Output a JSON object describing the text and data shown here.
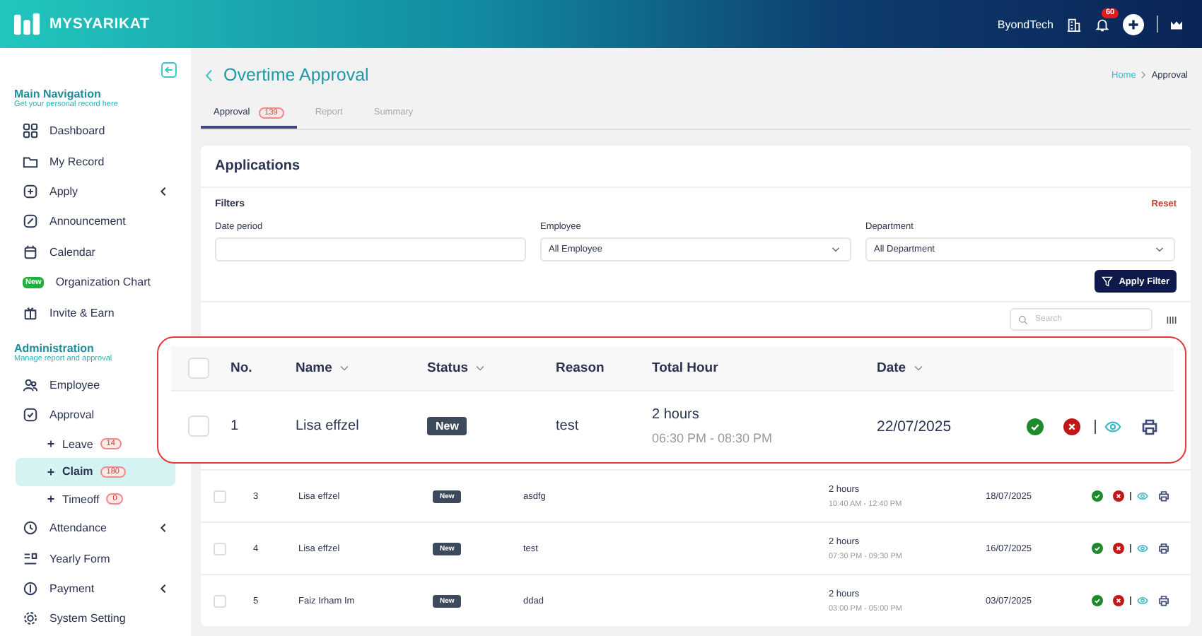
{
  "topbar": {
    "brand": "MYSYARIKAT",
    "company": "ByondTech",
    "notification_count": "60"
  },
  "sidebar": {
    "sections": [
      {
        "title": "Main Navigation",
        "subtitle": "Get your personal record here",
        "items": [
          {
            "label": "Dashboard"
          },
          {
            "label": "My Record"
          },
          {
            "label": "Apply",
            "expanded": false
          },
          {
            "label": "Announcement"
          },
          {
            "label": "Calendar"
          },
          {
            "label": "Organization Chart",
            "tag": "New"
          },
          {
            "label": "Invite & Earn"
          }
        ]
      },
      {
        "title": "Administration",
        "subtitle": "Manage report and approval",
        "items": [
          {
            "label": "Employee"
          },
          {
            "label": "Approval",
            "expanded": true,
            "children": [
              {
                "label": "Leave",
                "count": "14",
                "selected": false
              },
              {
                "label": "Claim",
                "count": "180",
                "selected": true
              },
              {
                "label": "Timeoff",
                "count": "0",
                "selected": false
              }
            ]
          },
          {
            "label": "Attendance",
            "expanded": false
          },
          {
            "label": "Yearly Form"
          },
          {
            "label": "Payment",
            "expanded": false
          },
          {
            "label": "System Setting"
          }
        ]
      }
    ]
  },
  "page": {
    "title": "Overtime Approval",
    "breadcrumb": [
      "Home",
      "Approval"
    ],
    "tabs": [
      {
        "label": "Approval",
        "count": "139",
        "selected": true
      },
      {
        "label": "Report",
        "selected": false
      },
      {
        "label": "Summary",
        "selected": false
      }
    ]
  },
  "card": {
    "title": "Applications",
    "filters_label": "Filters",
    "reset": "Reset",
    "filters": [
      {
        "label": "Date period",
        "kind": "text"
      },
      {
        "label": "Employee",
        "kind": "select",
        "value": "All Employee"
      },
      {
        "label": "Department",
        "kind": "select",
        "value": "All Department"
      }
    ],
    "apply_button": "Apply Filter",
    "search": {
      "placeholder": "Search"
    }
  },
  "table": {
    "rows": [
      {
        "checked": false,
        "no": "3",
        "name": "Lisa effzel",
        "status": "New",
        "reason": "asdfg",
        "hours": "2 hours",
        "time": "10:40 AM - 12:40 PM",
        "date": "18/07/2025"
      },
      {
        "checked": false,
        "no": "4",
        "name": "Lisa effzel",
        "status": "New",
        "reason": "test",
        "hours": "2 hours",
        "time": "07:30 PM - 09:30 PM",
        "date": "16/07/2025"
      },
      {
        "checked": false,
        "no": "5",
        "name": "Faiz Irham Im",
        "status": "New",
        "reason": "ddad",
        "hours": "2 hours",
        "time": "03:00 PM - 05:00 PM",
        "date": "03/07/2025"
      }
    ]
  },
  "callout": {
    "header_checked": false,
    "columns": [
      {
        "label": "No.",
        "sortable": false
      },
      {
        "label": "Name",
        "sortable": true
      },
      {
        "label": "Status",
        "sortable": true
      },
      {
        "label": "Reason",
        "sortable": false
      },
      {
        "label": "Total Hour",
        "sortable": false
      },
      {
        "label": "Date",
        "sortable": true
      }
    ],
    "row": {
      "checked": false,
      "no": "1",
      "name": "Lisa effzel",
      "status": "New",
      "reason": "test",
      "hours": "2 hours",
      "time": "06:30 PM - 08:30 PM",
      "date": "22/07/2025"
    }
  }
}
